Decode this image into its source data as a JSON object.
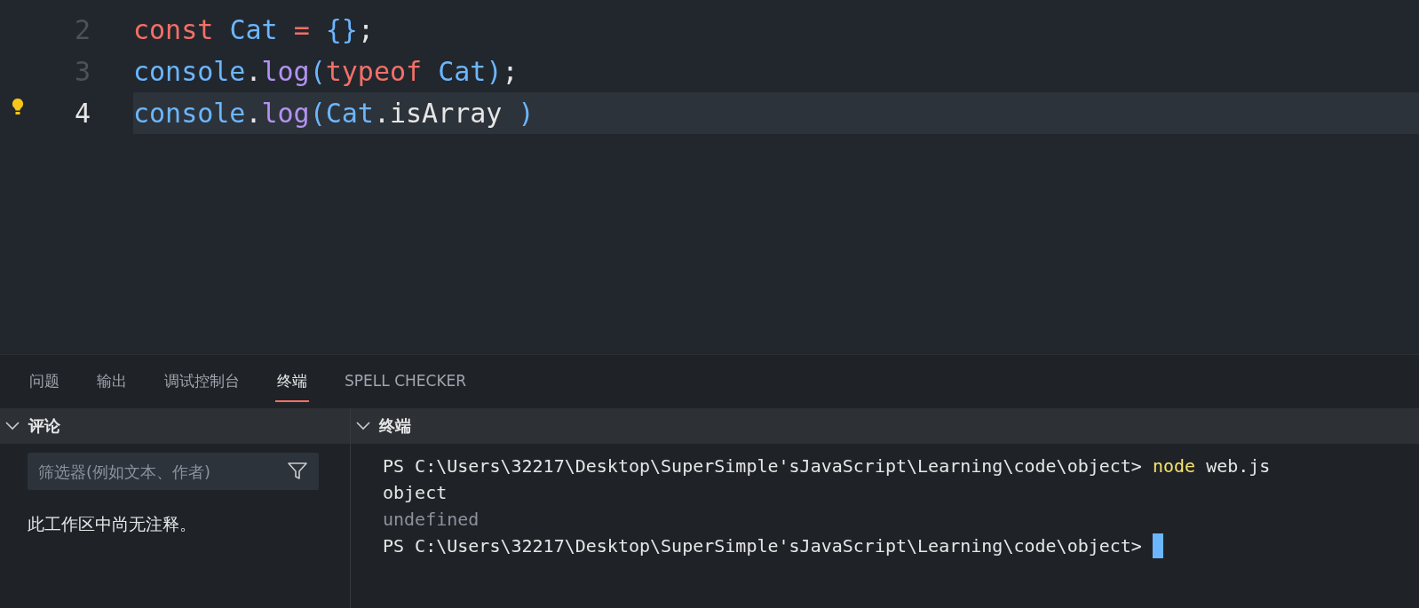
{
  "editor": {
    "lines": [
      {
        "number": "2",
        "current": false,
        "tokens": [
          {
            "text": "const ",
            "kind": "keyword"
          },
          {
            "text": "Cat ",
            "kind": "variable"
          },
          {
            "text": "= ",
            "kind": "keyword"
          },
          {
            "text": "{}",
            "kind": "variable"
          },
          {
            "text": ";",
            "kind": "plain"
          }
        ]
      },
      {
        "number": "3",
        "current": false,
        "tokens": [
          {
            "text": "console",
            "kind": "variable"
          },
          {
            "text": ".",
            "kind": "plain"
          },
          {
            "text": "log",
            "kind": "function"
          },
          {
            "text": "(",
            "kind": "variable"
          },
          {
            "text": "typeof ",
            "kind": "keyword"
          },
          {
            "text": "Cat",
            "kind": "variable"
          },
          {
            "text": ")",
            "kind": "variable"
          },
          {
            "text": ";",
            "kind": "plain"
          }
        ]
      },
      {
        "number": "4",
        "current": true,
        "tokens": [
          {
            "text": "console",
            "kind": "variable"
          },
          {
            "text": ".",
            "kind": "plain"
          },
          {
            "text": "log",
            "kind": "function"
          },
          {
            "text": "(",
            "kind": "variable"
          },
          {
            "text": "Cat",
            "kind": "variable"
          },
          {
            "text": ".isArray ",
            "kind": "plain"
          },
          {
            "text": ")",
            "kind": "variable"
          }
        ]
      }
    ]
  },
  "panel": {
    "tabs": [
      {
        "label": "问题",
        "selected": false
      },
      {
        "label": "输出",
        "selected": false
      },
      {
        "label": "调试控制台",
        "selected": false
      },
      {
        "label": "终端",
        "selected": true
      },
      {
        "label": "SPELL CHECKER",
        "selected": false
      }
    ]
  },
  "comments": {
    "title": "评论",
    "expanded": true,
    "filter": {
      "placeholder": "筛选器(例如文本、作者)"
    },
    "empty_message": "此工作区中尚无注释。"
  },
  "terminal": {
    "title": "终端",
    "expanded": true,
    "lines": [
      {
        "cursor": false,
        "segments": [
          {
            "text": "PS C:\\Users\\32217\\Desktop\\SuperSimple'sJavaScript\\Learning\\code\\object> ",
            "kind": "output"
          },
          {
            "text": "node",
            "kind": "command"
          },
          {
            "text": " web.js",
            "kind": "output"
          }
        ]
      },
      {
        "cursor": false,
        "segments": [
          {
            "text": "object",
            "kind": "output"
          }
        ]
      },
      {
        "cursor": false,
        "segments": [
          {
            "text": "undefined",
            "kind": "dim"
          }
        ]
      },
      {
        "cursor": true,
        "segments": [
          {
            "text": "PS C:\\Users\\32217\\Desktop\\SuperSimple'sJavaScript\\Learning\\code\\object> ",
            "kind": "output"
          }
        ]
      }
    ]
  }
}
